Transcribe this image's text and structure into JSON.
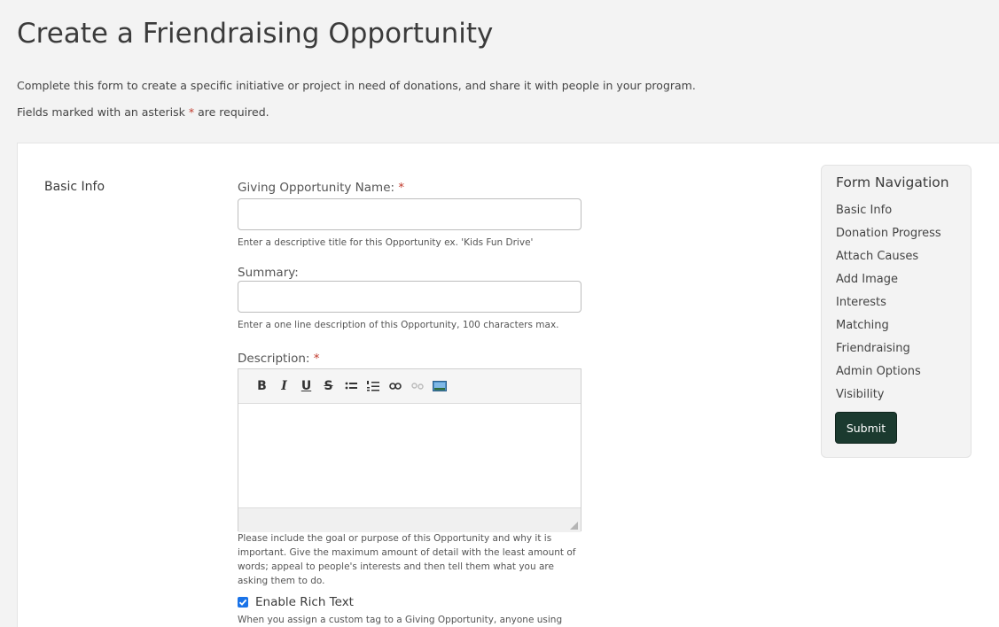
{
  "header": {
    "title": "Create a Friendraising Opportunity",
    "intro": "Complete this form to create a specific initiative or project in need of donations, and share it with people in your program.",
    "required_prefix": "Fields marked with an asterisk ",
    "required_asterisk": "*",
    "required_suffix": " are required."
  },
  "section": {
    "label": "Basic Info"
  },
  "form": {
    "name_label": "Giving Opportunity Name:",
    "name_value": "",
    "name_help": "Enter a descriptive title for this Opportunity ex. 'Kids Fun Drive'",
    "summary_label": "Summary:",
    "summary_value": "",
    "summary_help": "Enter a one line description of this Opportunity, 100 characters max.",
    "description_label": "Description:",
    "description_help": "Please include the goal or purpose of this Opportunity and why it is important. Give the maximum amount of detail with the least amount of words; appeal to people's interests and then tell them what you are asking them to do.",
    "rich_text_label": "Enable Rich Text",
    "rich_text_checked": true,
    "custom_tag_help": "When you assign a custom tag to a Giving Opportunity, anyone using",
    "asterisk": "*"
  },
  "editor": {
    "toolbar": [
      {
        "name": "bold-button",
        "glyph": "B"
      },
      {
        "name": "italic-button",
        "glyph": "I"
      },
      {
        "name": "underline-button",
        "glyph": "U"
      },
      {
        "name": "strikethrough-button",
        "glyph": "S"
      },
      {
        "name": "bullet-list-icon",
        "glyph": ""
      },
      {
        "name": "numbered-list-icon",
        "glyph": ""
      },
      {
        "name": "link-icon",
        "glyph": ""
      },
      {
        "name": "unlink-icon",
        "glyph": ""
      },
      {
        "name": "image-icon",
        "glyph": ""
      }
    ]
  },
  "navigation": {
    "title": "Form Navigation",
    "items": [
      "Basic Info",
      "Donation Progress",
      "Attach Causes",
      "Add Image",
      "Interests",
      "Matching",
      "Friendraising",
      "Admin Options",
      "Visibility"
    ],
    "submit_label": "Submit"
  },
  "colors": {
    "asterisk": "#c0392b",
    "submit_bg": "#1b3a2f",
    "checkbox": "#1a73e8"
  }
}
